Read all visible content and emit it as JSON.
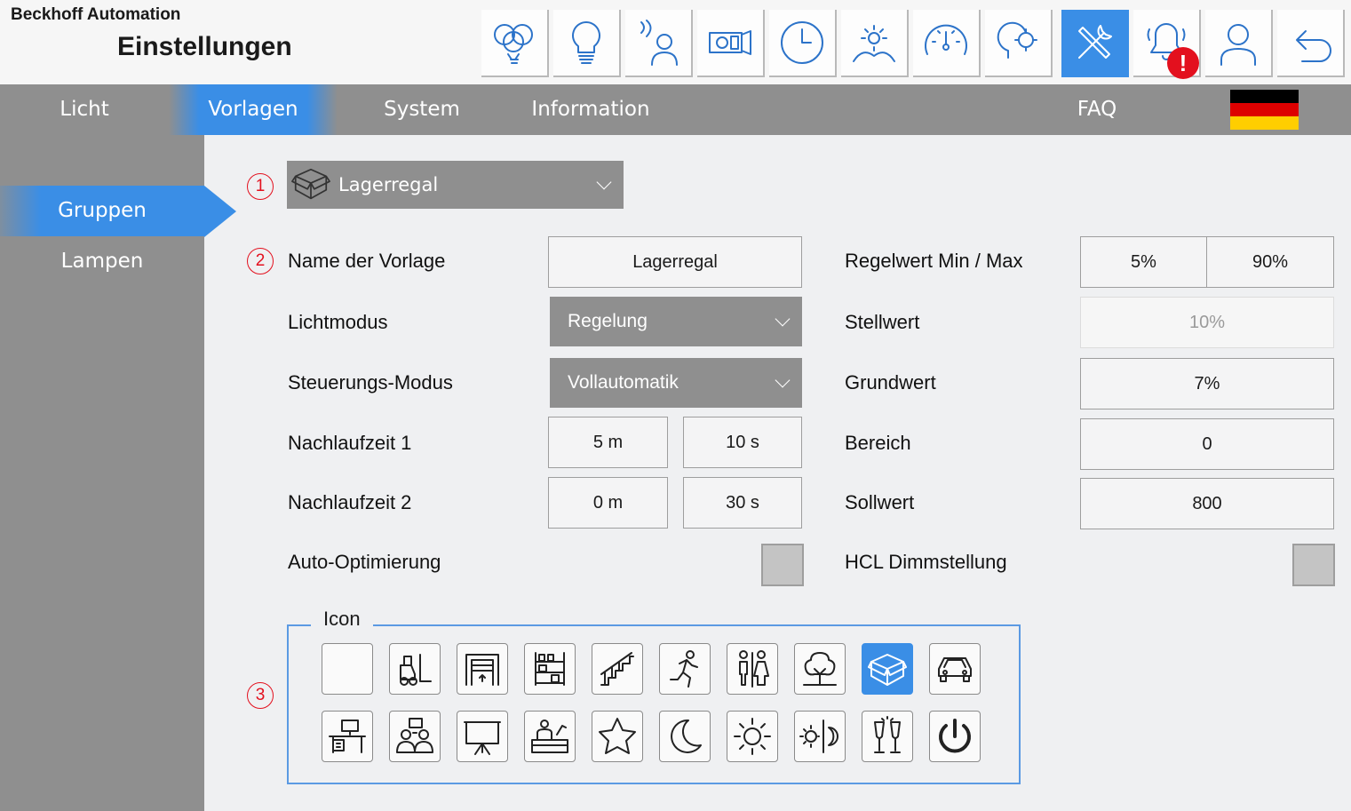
{
  "header": {
    "company": "Beckhoff Automation",
    "title": "Einstellungen"
  },
  "toolbar": {
    "buttons": [
      {
        "name": "balloons-icon"
      },
      {
        "name": "lightbulb-icon"
      },
      {
        "name": "motion-person-icon"
      },
      {
        "name": "projector-icon"
      },
      {
        "name": "clock-icon"
      },
      {
        "name": "sunrise-icon"
      },
      {
        "name": "gauge-icon"
      },
      {
        "name": "gear-head-icon"
      },
      {
        "name": "tools-icon",
        "active": true
      },
      {
        "name": "alarm-bell-icon",
        "badge": "!"
      },
      {
        "name": "user-icon"
      },
      {
        "name": "undo-arrow-icon"
      }
    ]
  },
  "nav": {
    "items": [
      "Licht",
      "Vorlagen",
      "System",
      "Information"
    ],
    "faq": "FAQ",
    "active": "Vorlagen",
    "language_flag": "flag-de-icon"
  },
  "sidebar": {
    "items": [
      "Gruppen",
      "Lampen"
    ],
    "active": "Gruppen"
  },
  "markers": [
    "1",
    "2",
    "3"
  ],
  "template_select": {
    "icon": "box-icon",
    "value": "Lagerregal"
  },
  "form": {
    "left": {
      "name_label": "Name der Vorlage",
      "name_value": "Lagerregal",
      "lichtmodus_label": "Lichtmodus",
      "lichtmodus_value": "Regelung",
      "steuerung_label": "Steuerungs-Modus",
      "steuerung_value": "Vollautomatik",
      "nachlauf1_label": "Nachlaufzeit 1",
      "nachlauf1_min": "5 m",
      "nachlauf1_sec": "10 s",
      "nachlauf2_label": "Nachlaufzeit 2",
      "nachlauf2_min": "0 m",
      "nachlauf2_sec": "30 s",
      "auto_label": "Auto-Optimierung"
    },
    "right": {
      "regelwert_label": "Regelwert Min / Max",
      "regelwert_min": "5%",
      "regelwert_max": "90%",
      "stellwert_label": "Stellwert",
      "stellwert_value": "10%",
      "grundwert_label": "Grundwert",
      "grundwert_value": "7%",
      "bereich_label": "Bereich",
      "bereich_value": "0",
      "sollwert_label": "Sollwert",
      "sollwert_value": "800",
      "hcl_label": "HCL Dimmstellung"
    }
  },
  "icon_group": {
    "legend": "Icon",
    "row1": [
      "empty-icon",
      "forklift-icon",
      "garage-door-icon",
      "shelving-icon",
      "stairs-icon",
      "running-person-icon",
      "restroom-icon",
      "tree-icon",
      "box-icon",
      "car-icon"
    ],
    "row2": [
      "desk-icon",
      "meeting-icon",
      "presentation-board-icon",
      "workbench-icon",
      "star-icon",
      "moon-icon",
      "sun-icon",
      "day-night-icon",
      "champagne-glasses-icon",
      "power-icon"
    ],
    "selected": "box-icon"
  },
  "colors": {
    "accent": "#3a8ee6",
    "nav_gray": "#8f8f8f",
    "background": "#eff0f2",
    "alert": "#e3101e"
  }
}
